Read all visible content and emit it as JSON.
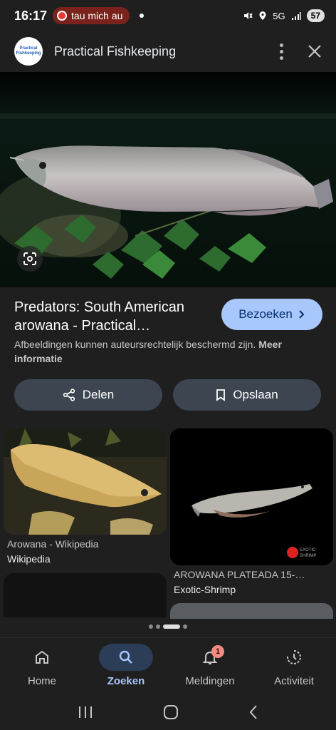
{
  "status_bar": {
    "time": "16:17",
    "notification_pill": "tau mich au",
    "signal": "5G",
    "battery": "57"
  },
  "header": {
    "site_name": "Practical Fishkeeping",
    "logo_text": "Practical Fishkeeping"
  },
  "result": {
    "title": "Predators: South American arowana - Practical…",
    "visit_label": "Bezoeken",
    "copyright_text": "Afbeeldingen kunnen auteursrechtelijk beschermd zijn.",
    "more_info": "Meer informatie",
    "share_label": "Delen",
    "save_label": "Opslaan"
  },
  "related": [
    {
      "title": "Arowana - Wikipedia",
      "source": "Wikipedia"
    },
    {
      "title": "AROWANA PLATEADA 15-…",
      "source": "Exotic-Shrimp",
      "watermark": "EXOTIC SHRIMP"
    }
  ],
  "bottom_nav": {
    "items": [
      {
        "label": "Home",
        "icon": "home-icon",
        "active": false
      },
      {
        "label": "Zoeken",
        "icon": "search-icon",
        "active": true
      },
      {
        "label": "Meldingen",
        "icon": "bell-icon",
        "active": false,
        "badge": "1"
      },
      {
        "label": "Activiteit",
        "icon": "history-icon",
        "active": false
      }
    ]
  },
  "colors": {
    "background": "#1f1f1f",
    "accent": "#a8c7fa",
    "button_bg": "#3c4550",
    "active_nav_bg": "#2c3d57"
  }
}
